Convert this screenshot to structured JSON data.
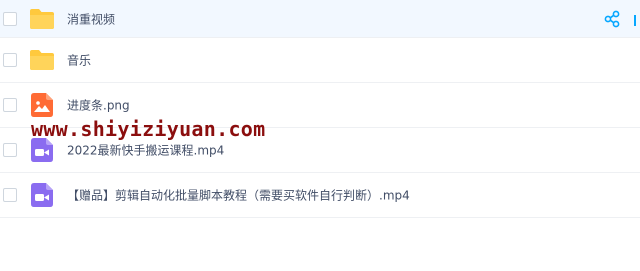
{
  "files": [
    {
      "name": "消重视频",
      "type": "folder-icon",
      "selected": true
    },
    {
      "name": "音乐",
      "type": "folder-icon",
      "selected": false
    },
    {
      "name": "进度条.png",
      "type": "image-file-icon",
      "selected": false
    },
    {
      "name": "2022最新快手搬运课程.mp4",
      "type": "video-file-icon",
      "selected": false
    },
    {
      "name": "【赠品】剪辑自动化批量脚本教程（需要买软件自行判断）.mp4",
      "type": "video-file-icon",
      "selected": false
    }
  ],
  "watermark": "www.shiyiziyuan.com",
  "colors": {
    "folder": "#ffc93d",
    "image_icon": "#ff6b35",
    "video_icon": "#8a6cf0",
    "accent": "#06a7ff",
    "selected_bg": "#f2f8ff"
  }
}
